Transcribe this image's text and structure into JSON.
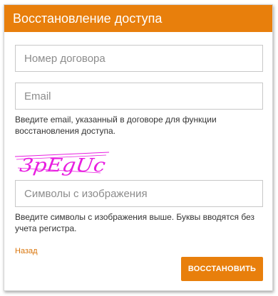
{
  "header": {
    "title": "Восстановление доступа"
  },
  "form": {
    "contract_placeholder": "Номер договора",
    "email_placeholder": "Email",
    "email_hint": "Введите email, указанный в договоре для функции восстановления доступа.",
    "captcha_text": "3pEgUc",
    "captcha_placeholder": "Символы с изображения",
    "captcha_hint": "Введите символы с изображения выше. Буквы вводятся без учета регистра.",
    "back_label": "Назад",
    "submit_label": "ВОССТАНОВИТЬ"
  },
  "colors": {
    "accent": "#e87f0c",
    "captcha": "#e81ee0"
  }
}
